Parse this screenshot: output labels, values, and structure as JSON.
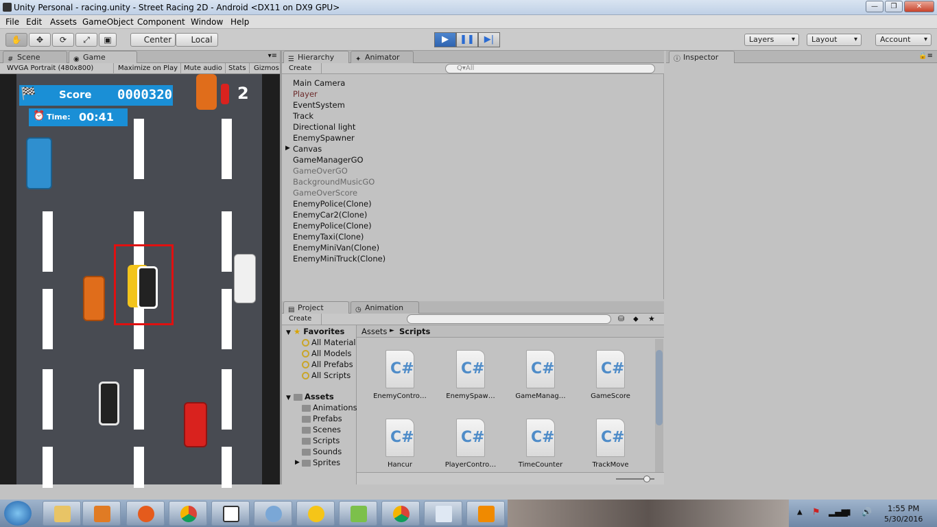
{
  "window": {
    "title": "Unity Personal - racing.unity - Street Racing 2D - Android <DX11 on DX9 GPU>",
    "buttons": [
      "—",
      "❐",
      "✕"
    ]
  },
  "menubar": [
    "File",
    "Edit",
    "Assets",
    "GameObject",
    "Component",
    "Window",
    "Help"
  ],
  "toolbar": {
    "pivot": "Center",
    "space": "Local",
    "play_icons": [
      "▶",
      "❚❚",
      "▶|"
    ],
    "layers": "Layers",
    "layout": "Layout",
    "account": "Account"
  },
  "game_panel": {
    "tabs": [
      "Scene",
      "Game"
    ],
    "resolution": "WVGA Portrait (480x800)",
    "maximize": "Maximize on Play",
    "mute": "Mute audio",
    "stats": "Stats",
    "gizmos": "Gizmos",
    "hud": {
      "score_label": "Score",
      "score_value": "0000320",
      "time_label": "Time:",
      "time_value": "00:41",
      "lives": "2"
    }
  },
  "hierarchy": {
    "tab": "Hierarchy",
    "tab2": "Animator",
    "create": "Create",
    "search_placeholder": "Q▾All",
    "items": [
      {
        "name": "Main Camera",
        "color": "#111111"
      },
      {
        "name": "Player",
        "color": "#6b2a2a"
      },
      {
        "name": "EventSystem",
        "color": "#111111"
      },
      {
        "name": "Track",
        "color": "#111111"
      },
      {
        "name": "Directional light",
        "color": "#111111"
      },
      {
        "name": "EnemySpawner",
        "color": "#111111"
      },
      {
        "name": "Canvas",
        "color": "#111111"
      },
      {
        "name": "GameManagerGO",
        "color": "#111111"
      },
      {
        "name": "GameOverGO",
        "color": "#6a6a6a"
      },
      {
        "name": "BackgroundMusicGO",
        "color": "#6a6a6a"
      },
      {
        "name": "GameOverScore",
        "color": "#6a6a6a"
      },
      {
        "name": "EnemyPolice(Clone)",
        "color": "#111111"
      },
      {
        "name": "EnemyCar2(Clone)",
        "color": "#111111"
      },
      {
        "name": "EnemyPolice(Clone)",
        "color": "#111111"
      },
      {
        "name": "EnemyTaxi(Clone)",
        "color": "#111111"
      },
      {
        "name": "EnemyMiniVan(Clone)",
        "color": "#111111"
      },
      {
        "name": "EnemyMiniTruck(Clone)",
        "color": "#111111"
      }
    ]
  },
  "inspector": {
    "tab": "Inspector"
  },
  "project": {
    "tab": "Project",
    "tab2": "Animation",
    "create": "Create",
    "favorites_label": "Favorites",
    "favorites": [
      "All Material",
      "All Models",
      "All Prefabs",
      "All Scripts"
    ],
    "assets_label": "Assets",
    "folders": [
      "Animations",
      "Prefabs",
      "Scenes",
      "Scripts",
      "Sounds",
      "Sprites"
    ],
    "breadcrumb": {
      "root": "Assets",
      "sep": "►",
      "current": "Scripts"
    },
    "scripts": [
      "EnemyContro…",
      "EnemySpaw…",
      "GameManag…",
      "GameScore",
      "Hancur",
      "PlayerContro…",
      "TimeCounter",
      "TrackMove"
    ]
  },
  "taskbar": {
    "time": "1:55 PM",
    "date": "5/30/2016"
  }
}
